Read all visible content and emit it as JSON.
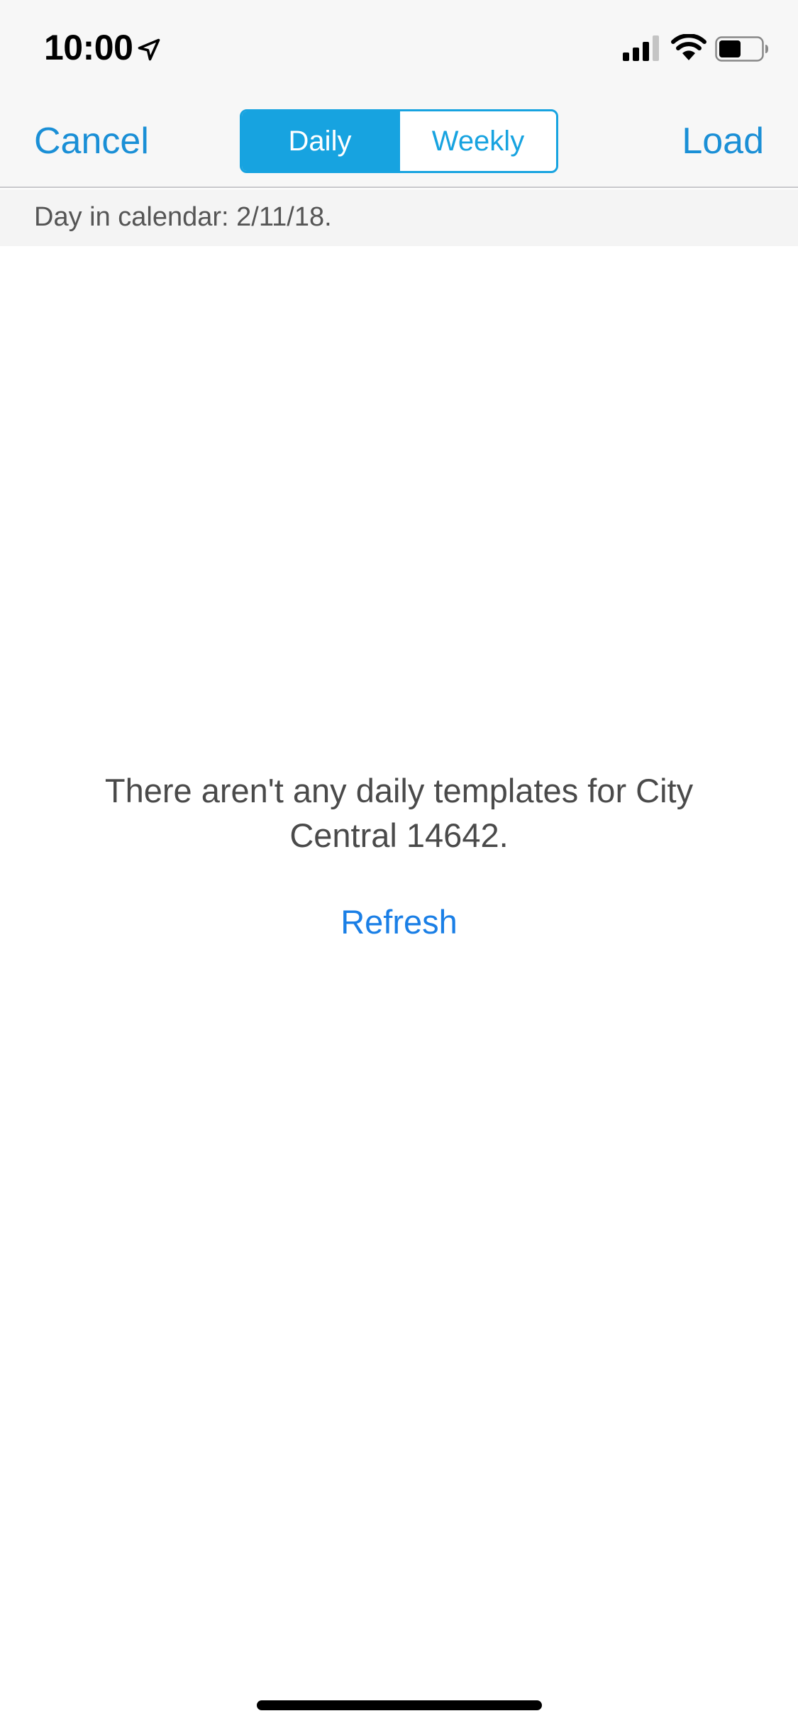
{
  "status_bar": {
    "time": "10:00",
    "icons": [
      "location-arrow-icon",
      "cellular-signal-icon",
      "wifi-icon",
      "battery-icon"
    ]
  },
  "nav": {
    "cancel_label": "Cancel",
    "load_label": "Load",
    "segments": [
      {
        "label": "Daily",
        "selected": true
      },
      {
        "label": "Weekly",
        "selected": false
      }
    ]
  },
  "sub_header": {
    "text": "Day in calendar: 2/11/18."
  },
  "empty_state": {
    "message": "There aren't any daily templates for City Central 14642.",
    "refresh_label": "Refresh"
  },
  "colors": {
    "accent": "#17a3e0",
    "link": "#1a8fd6",
    "refresh_link": "#1a7fe6",
    "bar_background": "#f7f7f7",
    "text_secondary": "#555555"
  }
}
